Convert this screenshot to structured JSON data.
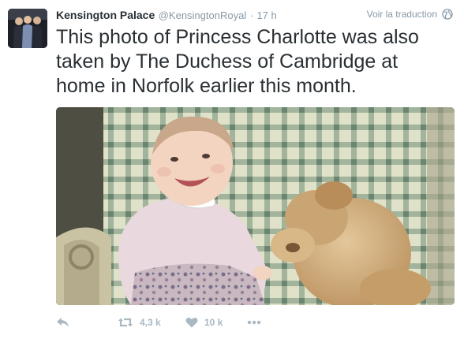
{
  "tweet": {
    "author_name": "Kensington Palace",
    "author_handle": "@KensingtonRoyal",
    "separator": "·",
    "timestamp": "17 h",
    "translate_label": "Voir la traduction",
    "text": "This photo of Princess Charlotte was also taken by The Duchess of Cambridge at home in Norfolk earlier this month.",
    "retweet_count": "4,3 k",
    "like_count": "10 k"
  },
  "icons": {
    "reply": "reply-icon",
    "retweet": "retweet-icon",
    "like": "heart-icon",
    "more": "more-dots-icon",
    "translate": "globe-icon"
  },
  "colors": {
    "text": "#292f33",
    "secondary": "#8899a6",
    "action": "#aab8c2"
  }
}
